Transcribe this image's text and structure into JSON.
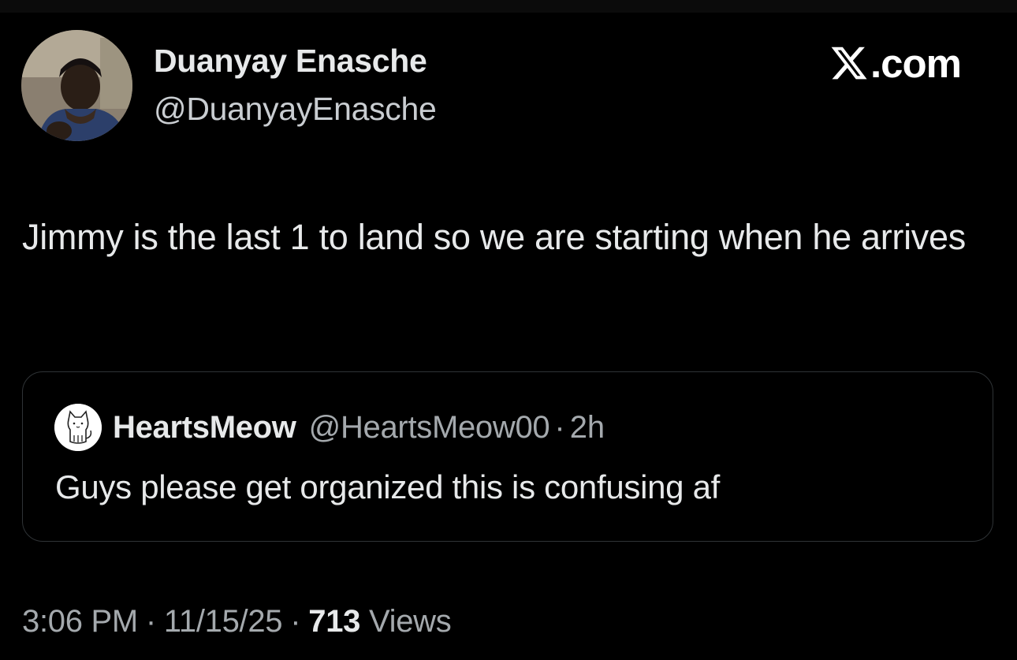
{
  "author": {
    "display_name": "Duanyay Enasche",
    "handle": "@DuanyayEnasche"
  },
  "brand": {
    "icon": "x-logo-icon",
    "label": ".com"
  },
  "tweet": {
    "text": "Jimmy is the last 1 to land so we are starting when he arrives"
  },
  "quoted_tweet": {
    "avatar_icon": "cat-icon",
    "display_name": "HeartsMeow",
    "handle": "@HeartsMeow00",
    "separator": "·",
    "time": "2h",
    "text": "Guys please get organized this is confusing af"
  },
  "meta": {
    "time": "3:06 PM",
    "separator": "·",
    "date": "11/15/25",
    "views_count": "713",
    "views_label": "Views"
  },
  "colors": {
    "background": "#000000",
    "primary_text": "#e7e9ea",
    "secondary_text": "#a4a9ad",
    "border": "#2f3336"
  }
}
